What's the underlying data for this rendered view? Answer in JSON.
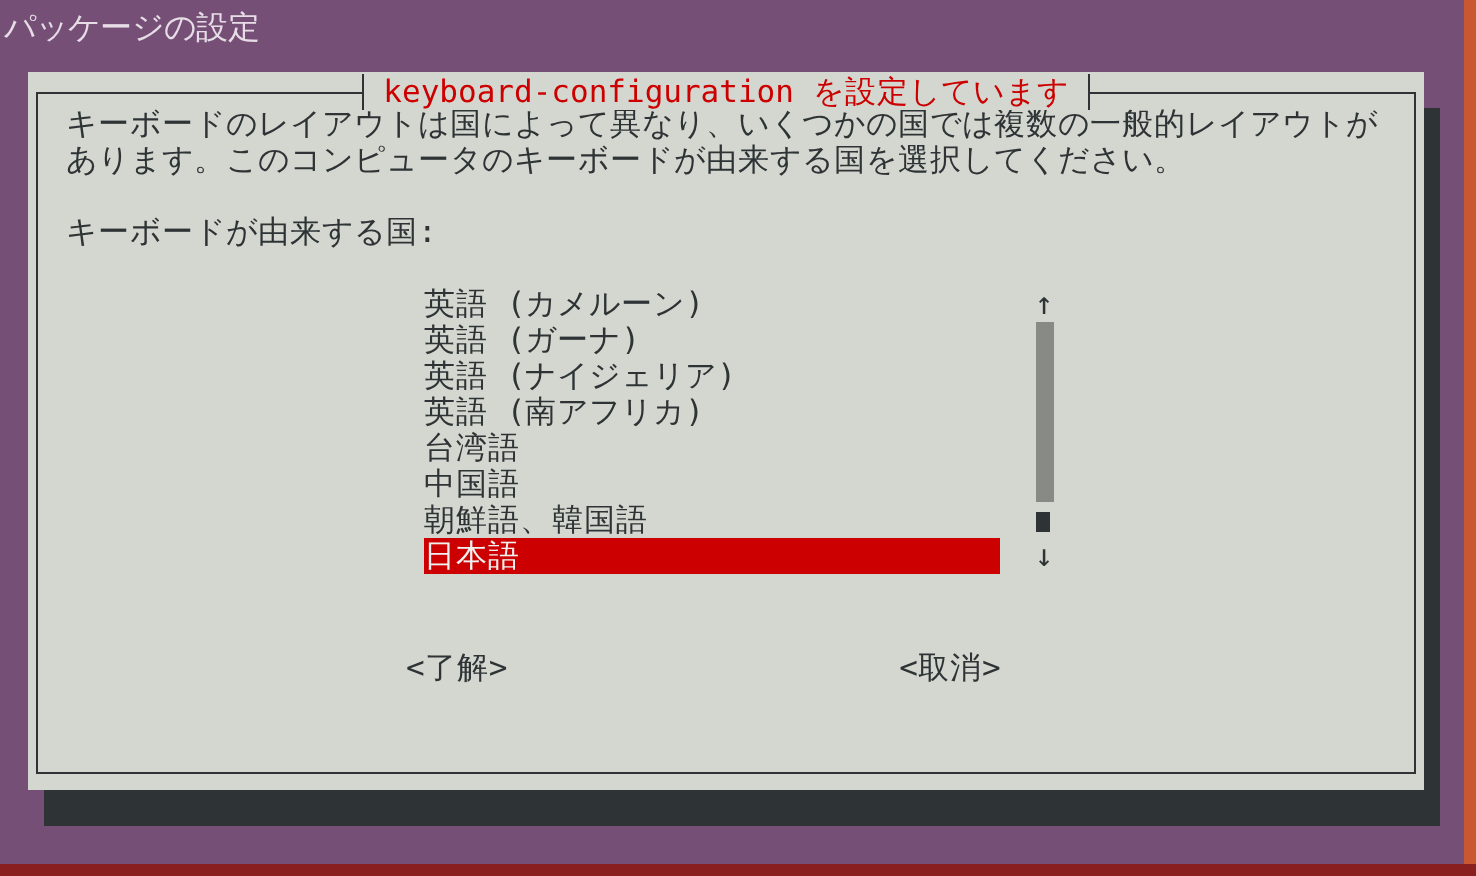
{
  "window": {
    "title": "パッケージの設定"
  },
  "dialog": {
    "title": "keyboard-configuration を設定しています",
    "message": "キーボードのレイアウトは国によって異なり、いくつかの国では複数の一般的レイアウトがあります。このコンピュータのキーボードが由来する国を選択してください。",
    "prompt": "キーボードが由来する国:",
    "items": [
      {
        "label": "英語 (カメルーン)",
        "selected": false
      },
      {
        "label": "英語 (ガーナ)",
        "selected": false
      },
      {
        "label": "英語 (ナイジェリア)",
        "selected": false
      },
      {
        "label": "英語 (南アフリカ)",
        "selected": false
      },
      {
        "label": "台湾語",
        "selected": false
      },
      {
        "label": "中国語",
        "selected": false
      },
      {
        "label": "朝鮮語、韓国語",
        "selected": false
      },
      {
        "label": "日本語",
        "selected": true
      }
    ],
    "scroll_up": "↑",
    "scroll_down": "↓",
    "buttons": [
      "<了解>",
      "<取消>"
    ]
  }
}
